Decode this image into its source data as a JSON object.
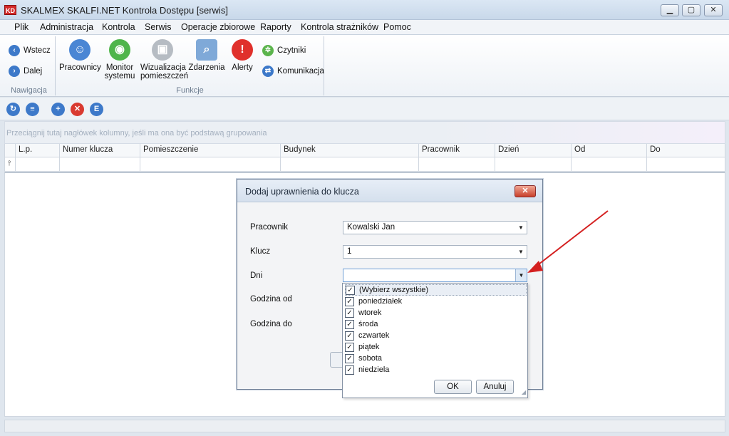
{
  "window": {
    "app_icon": "KD",
    "title": "SKALMEX SKALFI.NET Kontrola Dostępu [serwis]",
    "controls": {
      "minimize": "▁",
      "maximize": "▢",
      "close": "✕"
    }
  },
  "menu": [
    "Plik",
    "Administracja",
    "Kontrola",
    "Serwis",
    "Operacje zbiorowe",
    "Raporty",
    "Kontrola strażników",
    "Pomoc"
  ],
  "ribbon": {
    "nav_group": {
      "label": "Nawigacja",
      "back": "Wstecz",
      "forward": "Dalej"
    },
    "func_group": {
      "label": "Funkcje",
      "employees": "Pracownicy",
      "monitor_line1": "Monitor",
      "monitor_line2": "systemu",
      "visual_line1": "Wizualizacja",
      "visual_line2": "pomieszczeń",
      "events": "Zdarzenia",
      "alerts": "Alerty",
      "readers": "Czytniki",
      "communication": "Komunikacja"
    }
  },
  "grid": {
    "group_hint": "Przeciągnij tutaj nagłówek kolumny, jeśli ma ona być podstawą grupowania",
    "columns": [
      "L.p.",
      "Numer klucza",
      "Pomieszczenie",
      "Budynek",
      "Pracownik",
      "Dzień",
      "Od",
      "Do"
    ]
  },
  "dialog": {
    "title": "Dodaj uprawnienia do klucza",
    "close": "✕",
    "fields": {
      "employee_label": "Pracownik",
      "employee_value": "Kowalski Jan",
      "key_label": "Klucz",
      "key_value": "1",
      "days_label": "Dni",
      "days_value": "",
      "hour_from_label": "Godzina od",
      "hour_to_label": "Godzina do"
    }
  },
  "days_dropdown": {
    "items": [
      {
        "label": "(Wybierz wszystkie)",
        "checked": true
      },
      {
        "label": "poniedziałek",
        "checked": true
      },
      {
        "label": "wtorek",
        "checked": true
      },
      {
        "label": "środa",
        "checked": true
      },
      {
        "label": "czwartek",
        "checked": true
      },
      {
        "label": "piątek",
        "checked": true
      },
      {
        "label": "sobota",
        "checked": true
      },
      {
        "label": "niedziela",
        "checked": true
      }
    ],
    "ok": "OK",
    "cancel": "Anuluj"
  },
  "colors": {
    "arrow": "#d42020",
    "accent": "#2f6fc4"
  }
}
